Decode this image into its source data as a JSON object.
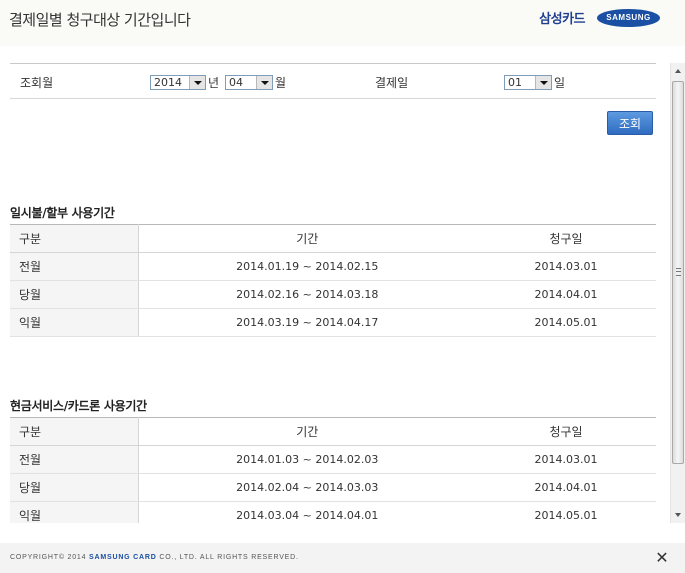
{
  "header": {
    "title": "결제일별 청구대상 기간입니다",
    "brand_name": "삼성카드",
    "brand_logo_text": "SAMSUNG"
  },
  "search": {
    "month_label": "조회월",
    "year_value": "2014",
    "year_unit": "년",
    "month_value": "04",
    "month_unit": "월",
    "payday_label": "결제일",
    "payday_value": "01",
    "payday_unit": "일",
    "search_button": "조회"
  },
  "sections": [
    {
      "title": "일시불/할부 사용기간",
      "columns": [
        "구분",
        "기간",
        "청구일"
      ],
      "rows": [
        [
          "전월",
          "2014.01.19 ~ 2014.02.15",
          "2014.03.01"
        ],
        [
          "당월",
          "2014.02.16 ~ 2014.03.18",
          "2014.04.01"
        ],
        [
          "익월",
          "2014.03.19 ~ 2014.04.17",
          "2014.05.01"
        ]
      ]
    },
    {
      "title": "현금서비스/카드론 사용기간",
      "columns": [
        "구분",
        "기간",
        "청구일"
      ],
      "rows": [
        [
          "전월",
          "2014.01.03 ~ 2014.02.03",
          "2014.03.01"
        ],
        [
          "당월",
          "2014.02.04 ~ 2014.03.03",
          "2014.04.01"
        ],
        [
          "익월",
          "2014.03.04 ~ 2014.04.01",
          "2014.05.01"
        ]
      ]
    }
  ],
  "footer": {
    "copyright_prefix": "COPYRIGHT© 2014",
    "copyright_company": "SAMSUNG CARD",
    "copyright_suffix": "CO., LTD. ALL RIGHTS RESERVED.",
    "close_glyph": "✕"
  },
  "icons": {
    "close": "close-icon",
    "dropdown": "chevron-down-icon"
  },
  "colors": {
    "brand": "#1b4fa3",
    "button": "#2f6cc0"
  }
}
